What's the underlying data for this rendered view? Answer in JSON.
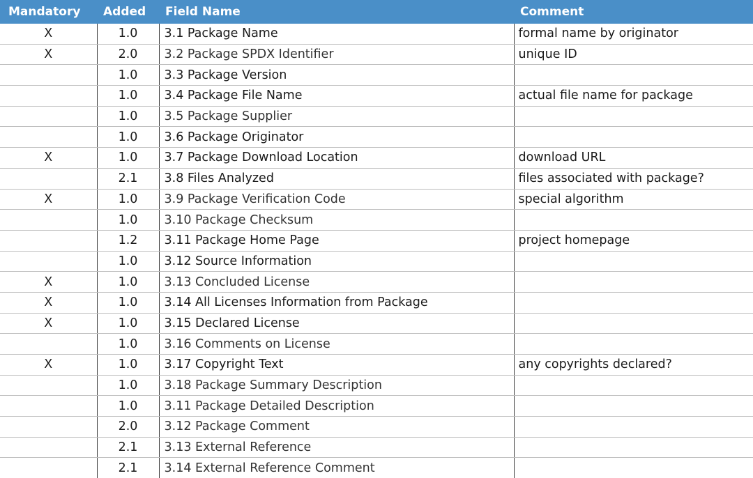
{
  "table": {
    "headers": {
      "mandatory": "Mandatory",
      "added": "Added",
      "field_name": "Field Name",
      "comment": "Comment"
    },
    "colors": {
      "header_background": "#4a8fc8",
      "header_text": "#ffffff"
    },
    "rows": [
      {
        "mandatory": "X",
        "added": "1.0",
        "field": "3.1 Package Name",
        "comment": "formal name by originator"
      },
      {
        "mandatory": "X",
        "added": "2.0",
        "field": "3.2 Package SPDX Identifier",
        "comment": "unique ID"
      },
      {
        "mandatory": "",
        "added": "1.0",
        "field": "3.3 Package Version",
        "comment": ""
      },
      {
        "mandatory": "",
        "added": "1.0",
        "field": "3.4 Package File Name",
        "comment": "actual file name for package"
      },
      {
        "mandatory": "",
        "added": "1.0",
        "field": "3.5 Package Supplier",
        "comment": ""
      },
      {
        "mandatory": "",
        "added": "1.0",
        "field": "3.6 Package Originator",
        "comment": ""
      },
      {
        "mandatory": "X",
        "added": "1.0",
        "field": "3.7 Package Download Location",
        "comment": "download URL"
      },
      {
        "mandatory": "",
        "added": "2.1",
        "field": "3.8 Files Analyzed",
        "comment": "files associated with package?"
      },
      {
        "mandatory": "X",
        "added": "1.0",
        "field": "3.9 Package Verification Code",
        "comment": "special algorithm"
      },
      {
        "mandatory": "",
        "added": "1.0",
        "field": "3.10 Package Checksum",
        "comment": ""
      },
      {
        "mandatory": "",
        "added": "1.2",
        "field": "3.11 Package Home Page",
        "comment": "project homepage"
      },
      {
        "mandatory": "",
        "added": "1.0",
        "field": "3.12 Source Information",
        "comment": ""
      },
      {
        "mandatory": "X",
        "added": "1.0",
        "field": "3.13 Concluded License",
        "comment": ""
      },
      {
        "mandatory": "X",
        "added": "1.0",
        "field": "3.14 All Licenses Information from Package",
        "comment": ""
      },
      {
        "mandatory": "X",
        "added": "1.0",
        "field": "3.15 Declared License",
        "comment": ""
      },
      {
        "mandatory": "",
        "added": "1.0",
        "field": "3.16 Comments on License",
        "comment": ""
      },
      {
        "mandatory": "X",
        "added": "1.0",
        "field": "3.17 Copyright Text",
        "comment": "any copyrights declared?"
      },
      {
        "mandatory": "",
        "added": "1.0",
        "field": "3.18 Package Summary Description",
        "comment": ""
      },
      {
        "mandatory": "",
        "added": "1.0",
        "field": "3.11 Package Detailed Description",
        "comment": ""
      },
      {
        "mandatory": "",
        "added": "2.0",
        "field": "3.12 Package Comment",
        "comment": ""
      },
      {
        "mandatory": "",
        "added": "2.1",
        "field": "3.13 External Reference",
        "comment": ""
      },
      {
        "mandatory": "",
        "added": "2.1",
        "field": "3.14 External Reference Comment",
        "comment": ""
      }
    ]
  }
}
